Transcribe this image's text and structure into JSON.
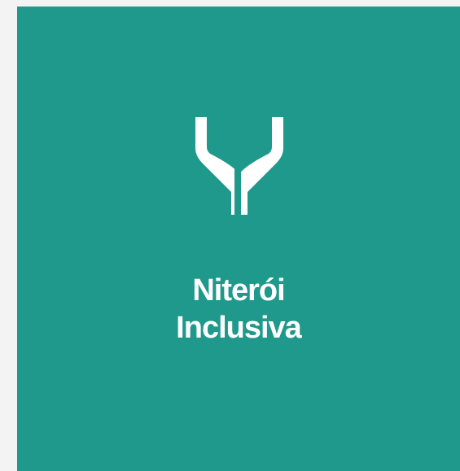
{
  "tile": {
    "title_line1": "Niterói",
    "title_line2": "Inclusiva",
    "icon": "open-hands-icon",
    "background_color": "#1e998b",
    "text_color": "#ffffff"
  }
}
